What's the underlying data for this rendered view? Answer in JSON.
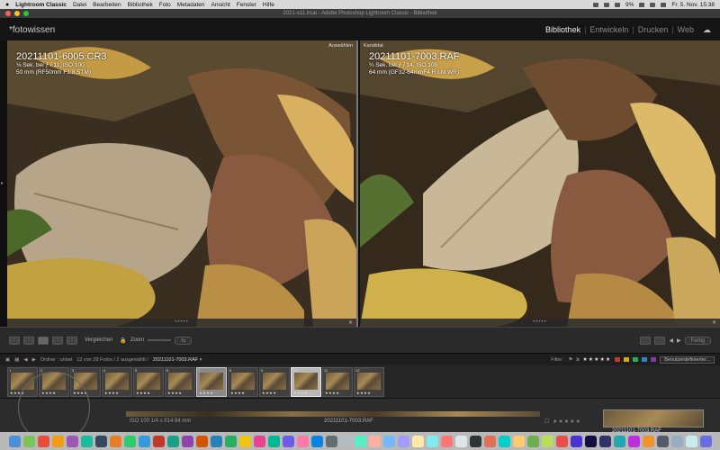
{
  "menubar": {
    "apple": "",
    "app": "Lightroom Classic",
    "items": [
      "Datei",
      "Bearbeiten",
      "Bibliothek",
      "Foto",
      "Metadaten",
      "Ansicht",
      "Fenster",
      "Hilfe"
    ],
    "battery": "9%",
    "clock": "Fr. 5. Nov. 15:38"
  },
  "window": {
    "title": "2021-x11.lrcat - Adobe Photoshop Lightroom Classic - Bibliothek"
  },
  "identity": {
    "brand": "*fotowissen",
    "modules": [
      "Bibliothek",
      "Entwickeln",
      "Drucken",
      "Web"
    ],
    "active_module": "Bibliothek"
  },
  "compare": {
    "left": {
      "tag": "Auswählen",
      "filename": "20211101-6005.CR3",
      "exposure": "⅛ Sek. bei ƒ / 11, ISO 100",
      "lens": "50 mm (RF50mm F1.8 STM)"
    },
    "right": {
      "tag": "Kandidat",
      "filename": "20211101-7003.RAF",
      "exposure": "¼ Sek. bei ƒ / 14, ISO 100",
      "lens": "64 mm (GF32-64mmF4 R LM WR)"
    }
  },
  "toolbar": {
    "compare_label": "Vergleichen",
    "zoom_label": "Zoom",
    "done_label": "Fertig"
  },
  "filmstrip_bar": {
    "source": "Ordner : unbet",
    "count": "12 von 28 Fotos / 2 ausgewählt /",
    "current_file": "20211101-7003.RAF",
    "filter_label": "Filter :",
    "filter_preset": "Benutzerdefinierter..."
  },
  "filmstrip": {
    "thumbs": [
      {
        "num": "1",
        "state": "normal"
      },
      {
        "num": "2",
        "state": "normal"
      },
      {
        "num": "3",
        "state": "normal"
      },
      {
        "num": "4",
        "state": "normal"
      },
      {
        "num": "5",
        "state": "normal"
      },
      {
        "num": "6",
        "state": "normal"
      },
      {
        "num": "7",
        "state": "selected"
      },
      {
        "num": "8",
        "state": "normal"
      },
      {
        "num": "9",
        "state": "normal"
      },
      {
        "num": "10",
        "state": "candidate"
      },
      {
        "num": "11",
        "state": "normal"
      },
      {
        "num": "12",
        "state": "normal"
      }
    ],
    "stars": "★★★★"
  },
  "behind": {
    "info": "ISO 100   1/4 s   f/14   64 mm",
    "filename": "20211101-7003.RAF",
    "filename2": "20211101-7003.RAF"
  },
  "colors": {
    "label_red": "#c0392b",
    "label_yellow": "#d4ac0d",
    "label_green": "#27ae60",
    "label_blue": "#2e86c1",
    "label_purple": "#7d3c98"
  }
}
